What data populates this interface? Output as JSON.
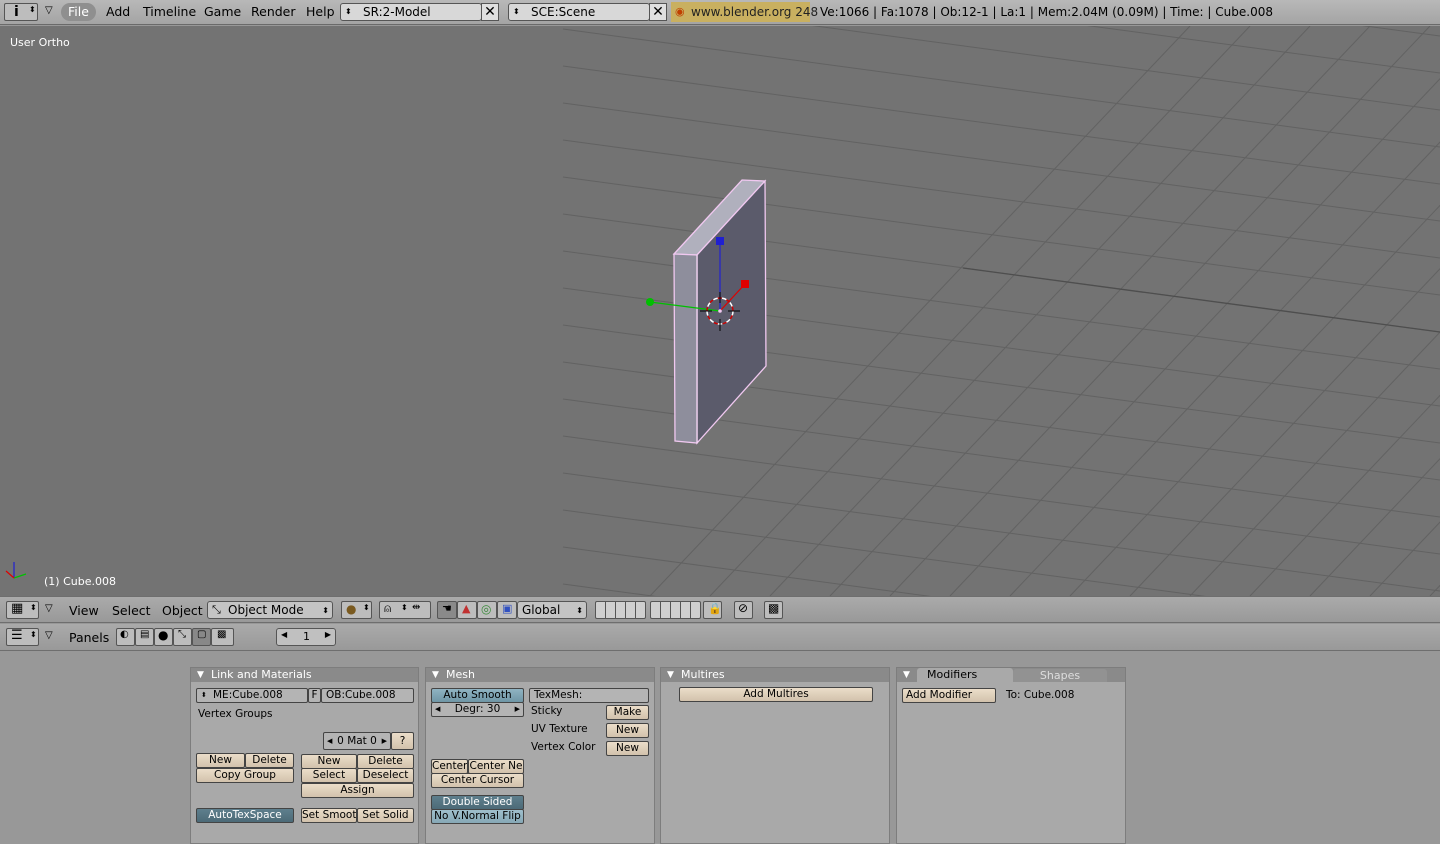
{
  "topbar": {
    "menus": [
      "File",
      "Add",
      "Timeline",
      "Game",
      "Render",
      "Help"
    ],
    "screen": "SR:2-Model",
    "scene": "SCE:Scene",
    "url": "www.blender.org 248",
    "stats": "Ve:1066 | Fa:1078 | Ob:12-1 | La:1  | Mem:2.04M (0.09M)  | Time: | Cube.008"
  },
  "viewport": {
    "view_label": "User Ortho",
    "object_label": "(1) Cube.008"
  },
  "view3d_header": {
    "menus": [
      "View",
      "Select",
      "Object"
    ],
    "mode": "Object Mode",
    "orientation": "Global"
  },
  "buttons_header": {
    "panels_label": "Panels",
    "frame": "1"
  },
  "link_materials": {
    "title": "Link and Materials",
    "me_field": "ME:Cube.008",
    "f_label": "F",
    "ob_field": "OB:Cube.008",
    "vertex_groups": "Vertex Groups",
    "mat_counter": "0 Mat 0",
    "question": "?",
    "new1": "New",
    "delete1": "Delete",
    "copy_group": "Copy Group",
    "new2": "New",
    "delete2": "Delete",
    "select": "Select",
    "deselect": "Deselect",
    "assign": "Assign",
    "autotexspace": "AutoTexSpace",
    "set_smooth": "Set Smoot",
    "set_solid": "Set Solid"
  },
  "mesh": {
    "title": "Mesh",
    "auto_smooth": "Auto Smooth",
    "degr": "Degr: 30",
    "texmesh": "TexMesh:",
    "sticky": "Sticky",
    "make": "Make",
    "uv_texture": "UV Texture",
    "uv_new": "New",
    "vertex_color": "Vertex Color",
    "vc_new": "New",
    "center": "Center",
    "center_new": "Center Ne",
    "center_cursor": "Center Cursor",
    "double_sided": "Double Sided",
    "no_vnormal_flip": "No V.Normal Flip"
  },
  "multires": {
    "title": "Multires",
    "add_multires": "Add Multires"
  },
  "modifiers": {
    "tab_modifiers": "Modifiers",
    "tab_shapes": "Shapes",
    "add_modifier": "Add Modifier",
    "to_label": "To: Cube.008"
  },
  "colors": {
    "viewport_bg": "#737373",
    "grid": "#5f5f5f",
    "selected_outline": "#f0c8f0",
    "axis_x": "#e00000",
    "axis_y": "#00c000",
    "axis_z": "#2020d0",
    "url_bg": "#c9b060"
  }
}
